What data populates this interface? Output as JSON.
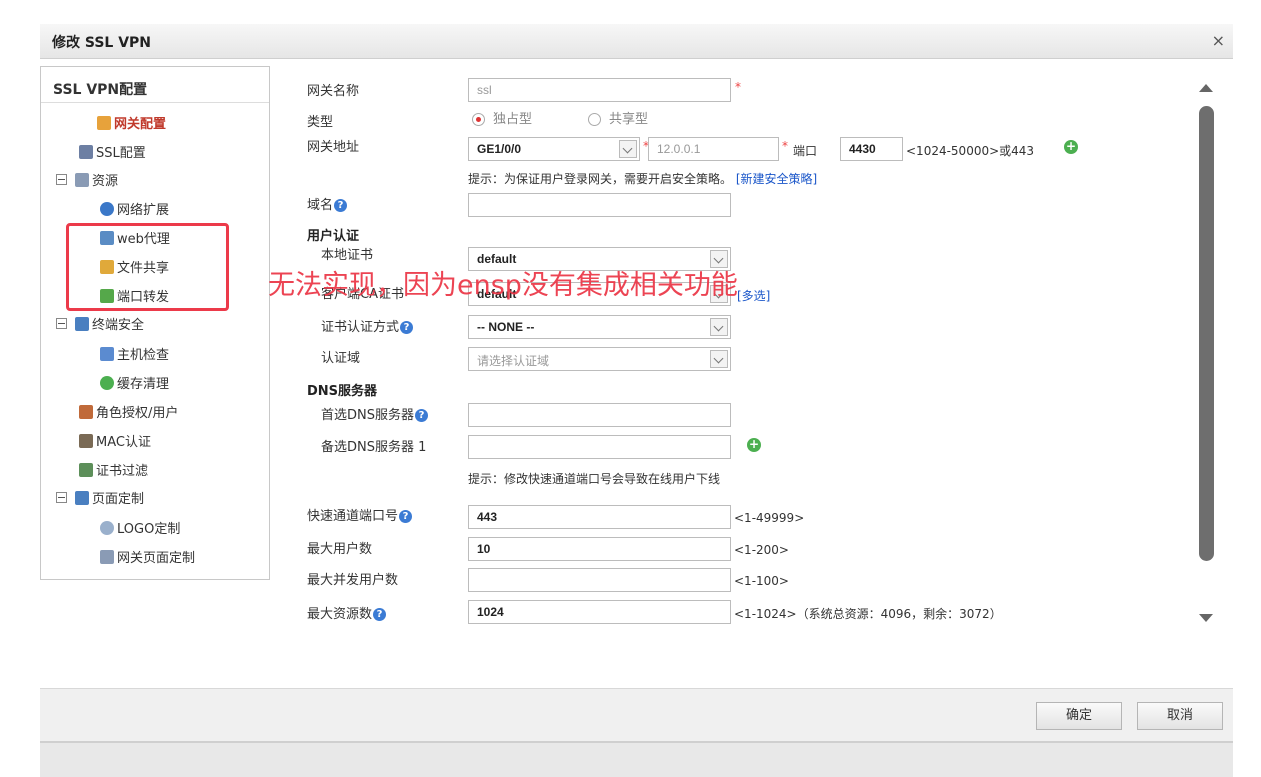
{
  "window": {
    "title": "修改 SSL VPN",
    "close": "×"
  },
  "nav": {
    "header": "SSL VPN配置",
    "items": [
      {
        "label": "网关配置",
        "icon": "gateway-config-icon"
      },
      {
        "label": "SSL配置",
        "icon": "ssl-config-icon"
      },
      {
        "label": "资源",
        "icon": "resource-icon"
      },
      {
        "label": "网络扩展",
        "icon": "network-extension-icon"
      },
      {
        "label": "web代理",
        "icon": "web-proxy-icon"
      },
      {
        "label": "文件共享",
        "icon": "file-share-icon"
      },
      {
        "label": "端口转发",
        "icon": "port-forward-icon"
      },
      {
        "label": "终端安全",
        "icon": "terminal-security-icon"
      },
      {
        "label": "主机检查",
        "icon": "host-check-icon"
      },
      {
        "label": "缓存清理",
        "icon": "cache-clean-icon"
      },
      {
        "label": "角色授权/用户",
        "icon": "role-user-icon"
      },
      {
        "label": "MAC认证",
        "icon": "mac-auth-icon"
      },
      {
        "label": "证书过滤",
        "icon": "cert-filter-icon"
      },
      {
        "label": "页面定制",
        "icon": "page-custom-icon"
      },
      {
        "label": "LOGO定制",
        "icon": "logo-custom-icon"
      },
      {
        "label": "网关页面定制",
        "icon": "gateway-page-icon"
      }
    ]
  },
  "annotation": "无法实现，因为ensp没有集成相关功能",
  "form": {
    "gateway_name_label": "网关名称",
    "gateway_name_value": "ssl",
    "type_label": "类型",
    "type_exclusive": "独占型",
    "type_shared": "共享型",
    "gateway_addr_label": "网关地址",
    "interface_value": "GE1/0/0",
    "ip_value": "12.0.0.1",
    "port_label": "端口",
    "port_value": "4430",
    "port_range": "<1024-50000>或443",
    "security_hint_prefix": "提示：为保证用户登录网关，需要开启安全策略。",
    "security_hint_link": "[新建安全策略]",
    "domain_label": "域名",
    "user_auth_section": "用户认证",
    "local_cert_label": "本地证书",
    "local_cert_value": "default",
    "client_ca_label": "客户端CA证书",
    "client_ca_value": "default",
    "multi_select": "[多选]",
    "cert_auth_label": "证书认证方式",
    "cert_auth_value": "-- NONE --",
    "auth_domain_label": "认证域",
    "auth_domain_placeholder": "请选择认证域",
    "dns_section": "DNS服务器",
    "dns_primary_label": "首选DNS服务器",
    "dns_backup_label": "备选DNS服务器 1",
    "fast_port_hint": "提示：修改快速通道端口号会导致在线用户下线",
    "fast_port_label": "快速通道端口号",
    "fast_port_value": "443",
    "fast_port_range": "<1-49999>",
    "max_users_label": "最大用户数",
    "max_users_value": "10",
    "max_users_range": "<1-200>",
    "max_concurrent_label": "最大并发用户数",
    "max_concurrent_range": "<1-100>",
    "max_resources_label": "最大资源数",
    "max_resources_value": "1024",
    "max_resources_range": "<1-1024>（系统总资源：4096，剩余：3072）",
    "required_mark": "*",
    "help_mark": "?"
  },
  "footer": {
    "ok": "确定",
    "cancel": "取消"
  }
}
